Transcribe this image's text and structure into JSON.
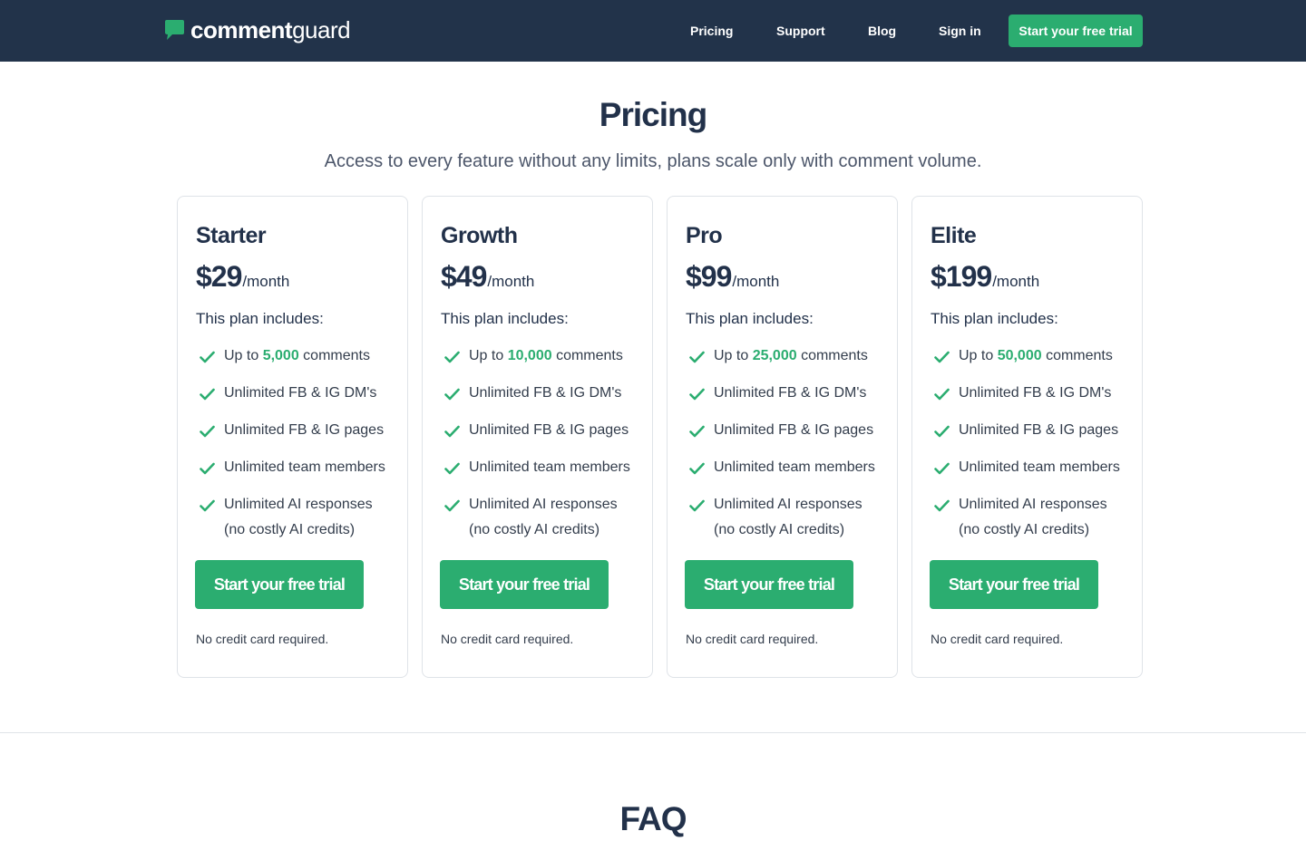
{
  "nav": {
    "logo_bold": "comment",
    "logo_light": "guard",
    "links": [
      "Pricing",
      "Support",
      "Blog",
      "Sign in"
    ],
    "cta": "Start your free trial"
  },
  "pricing": {
    "title": "Pricing",
    "subtitle": "Access to every feature without any limits, plans scale only with comment volume.",
    "plans": [
      {
        "name": "Starter",
        "price": "$29",
        "period": "/month",
        "includes": "This plan includes:",
        "comments_prefix": "Up to ",
        "comments_amount": "5,000",
        "comments_suffix": " comments",
        "features": [
          "Unlimited FB & IG DM's",
          "Unlimited FB & IG pages",
          "Unlimited team members"
        ],
        "ai_line1": "Unlimited AI responses",
        "ai_line2": "(no costly AI credits)",
        "cta": "Start your free trial",
        "note": "No credit card required."
      },
      {
        "name": "Growth",
        "price": "$49",
        "period": "/month",
        "includes": "This plan includes:",
        "comments_prefix": "Up to ",
        "comments_amount": "10,000",
        "comments_suffix": " comments",
        "features": [
          "Unlimited FB & IG DM's",
          "Unlimited FB & IG pages",
          "Unlimited team members"
        ],
        "ai_line1": "Unlimited AI responses",
        "ai_line2": "(no costly AI credits)",
        "cta": "Start your free trial",
        "note": "No credit card required."
      },
      {
        "name": "Pro",
        "price": "$99",
        "period": "/month",
        "includes": "This plan includes:",
        "comments_prefix": "Up to ",
        "comments_amount": "25,000",
        "comments_suffix": " comments",
        "features": [
          "Unlimited FB & IG DM's",
          "Unlimited FB & IG pages",
          "Unlimited team members"
        ],
        "ai_line1": "Unlimited AI responses",
        "ai_line2": "(no costly AI credits)",
        "cta": "Start your free trial",
        "note": "No credit card required."
      },
      {
        "name": "Elite",
        "price": "$199",
        "period": "/month",
        "includes": "This plan includes:",
        "comments_prefix": "Up to ",
        "comments_amount": "50,000",
        "comments_suffix": " comments",
        "features": [
          "Unlimited FB & IG DM's",
          "Unlimited FB & IG pages",
          "Unlimited team members"
        ],
        "ai_line1": "Unlimited AI responses",
        "ai_line2": "(no costly AI credits)",
        "cta": "Start your free trial",
        "note": "No credit card required."
      }
    ]
  },
  "faq": {
    "title": "FAQ"
  },
  "colors": {
    "navy": "#22334a",
    "accent_green": "#2bad70",
    "text_dark": "#22314a"
  }
}
